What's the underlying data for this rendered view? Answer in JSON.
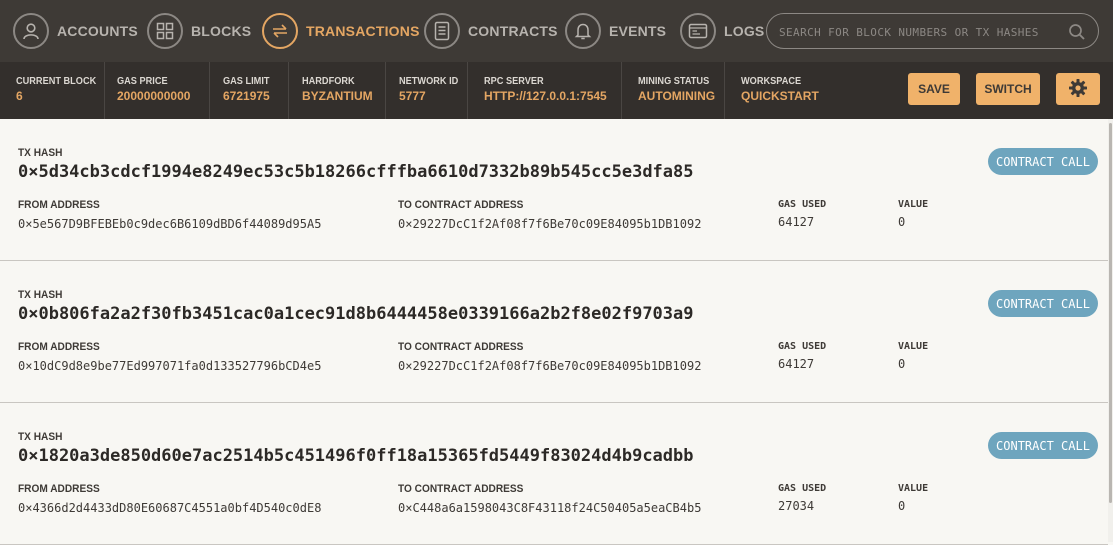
{
  "nav": {
    "items": [
      {
        "label": "ACCOUNTS",
        "icon": "user-icon"
      },
      {
        "label": "BLOCKS",
        "icon": "blocks-icon"
      },
      {
        "label": "TRANSACTIONS",
        "icon": "transfer-icon",
        "active": true
      },
      {
        "label": "CONTRACTS",
        "icon": "document-icon"
      },
      {
        "label": "EVENTS",
        "icon": "bell-icon"
      },
      {
        "label": "LOGS",
        "icon": "terminal-icon"
      }
    ],
    "search_placeholder": "SEARCH FOR BLOCK NUMBERS OR TX HASHES"
  },
  "status": {
    "current_block": {
      "label": "CURRENT BLOCK",
      "value": "6"
    },
    "gas_price": {
      "label": "GAS PRICE",
      "value": "20000000000"
    },
    "gas_limit": {
      "label": "GAS LIMIT",
      "value": "6721975"
    },
    "hardfork": {
      "label": "HARDFORK",
      "value": "BYZANTIUM"
    },
    "network_id": {
      "label": "NETWORK ID",
      "value": "5777"
    },
    "rpc_server": {
      "label": "RPC SERVER",
      "value": "HTTP://127.0.0.1:7545"
    },
    "mining_status": {
      "label": "MINING STATUS",
      "value": "AUTOMINING"
    },
    "workspace": {
      "label": "WORKSPACE",
      "value": "QUICKSTART"
    },
    "save_label": "SAVE",
    "switch_label": "SWITCH"
  },
  "labels": {
    "tx_hash": "TX HASH",
    "from_address": "FROM ADDRESS",
    "to_contract_address": "TO CONTRACT ADDRESS",
    "gas_used": "GAS USED",
    "value": "VALUE"
  },
  "transactions": [
    {
      "hash": "0×5d34cb3cdcf1994e8249ec53c5b18266cfffba6610d7332b89b545cc5e3dfa85",
      "from": "0×5e567D9BFEBEb0c9dec6B6109dBD6f44089d95A5",
      "to": "0×29227DcC1f2Af08f7f6Be70c09E84095b1DB1092",
      "gas_used": "64127",
      "value": "0",
      "type": "CONTRACT CALL"
    },
    {
      "hash": "0×0b806fa2a2f30fb3451cac0a1cec91d8b6444458e0339166a2b2f8e02f9703a9",
      "from": "0×10dC9d8e9be77Ed997071fa0d133527796bCD4e5",
      "to": "0×29227DcC1f2Af08f7f6Be70c09E84095b1DB1092",
      "gas_used": "64127",
      "value": "0",
      "type": "CONTRACT CALL"
    },
    {
      "hash": "0×1820a3de850d60e7ac2514b5c451496f0ff18a15365fd5449f83024d4b9cadbb",
      "from": "0×4366d2d4433dD80E60687C4551a0bf4D540c0dE8",
      "to": "0×C448a6a1598043C8F43118f24C50405a5eaCB4b5",
      "gas_used": "27034",
      "value": "0",
      "type": "CONTRACT CALL"
    }
  ],
  "colors": {
    "nav_bg": "#3e3a36",
    "status_bg": "#332f2c",
    "accent": "#e4a663",
    "button": "#f0b26a",
    "badge": "#6ea5be",
    "page_bg": "#f8f7f3"
  }
}
